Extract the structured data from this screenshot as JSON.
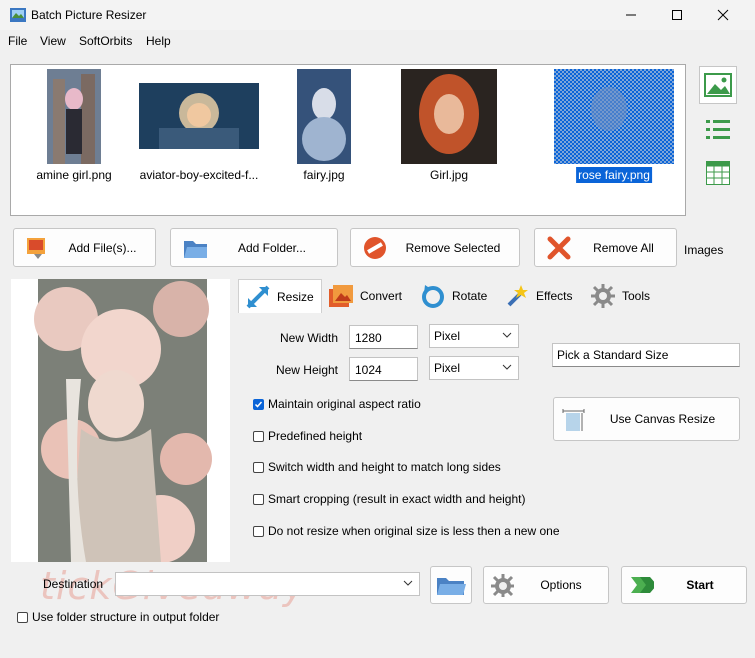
{
  "window": {
    "title": "Batch Picture Resizer"
  },
  "menu": [
    "File",
    "View",
    "SoftOrbits",
    "Help"
  ],
  "thumbnails": [
    {
      "caption": "amine girl.png",
      "selected": false
    },
    {
      "caption": "aviator-boy-excited-f...",
      "selected": false
    },
    {
      "caption": "fairy.jpg",
      "selected": false
    },
    {
      "caption": "Girl.jpg",
      "selected": false
    },
    {
      "caption": "rose fairy.png",
      "selected": true
    }
  ],
  "view_icons": [
    "image-view-icon",
    "list-view-icon",
    "grid-view-icon"
  ],
  "file_buttons": {
    "add_files": "Add File(s)...",
    "add_folder": "Add Folder...",
    "remove_selected": "Remove Selected",
    "remove_all": "Remove All",
    "images_label": "Images"
  },
  "tabs": [
    {
      "label": "Resize",
      "icon": "resize-icon",
      "active": true
    },
    {
      "label": "Convert",
      "icon": "convert-icon",
      "active": false
    },
    {
      "label": "Rotate",
      "icon": "rotate-icon",
      "active": false
    },
    {
      "label": "Effects",
      "icon": "effects-icon",
      "active": false
    },
    {
      "label": "Tools",
      "icon": "tools-icon",
      "active": false
    }
  ],
  "resize": {
    "new_width_label": "New Width",
    "new_width_value": "1280",
    "new_width_unit": "Pixel",
    "new_height_label": "New Height",
    "new_height_value": "1024",
    "new_height_unit": "Pixel",
    "standard_size": "Pick a Standard Size",
    "canvas_button": "Use Canvas Resize",
    "options": [
      {
        "label": "Maintain original aspect ratio",
        "checked": true
      },
      {
        "label": "Predefined height",
        "checked": false
      },
      {
        "label": "Switch width and height to match long sides",
        "checked": false
      },
      {
        "label": "Smart cropping (result in exact width and height)",
        "checked": false
      },
      {
        "label": "Do not resize when original size is less then a new one",
        "checked": false
      }
    ]
  },
  "bottom": {
    "destination_label": "Destination",
    "destination_value": "",
    "options_button": "Options",
    "start_button": "Start",
    "folder_structure_label": "Use folder structure in output folder",
    "folder_structure_checked": false,
    "watermark_text": "tickGiveaway"
  },
  "colors": {
    "selection": "#0a64d8",
    "accent_green": "#4caf50",
    "remove_red": "#e0542b"
  }
}
